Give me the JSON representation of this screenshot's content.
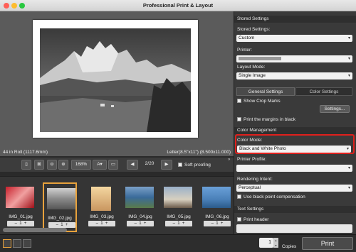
{
  "window": {
    "title": "Professional Print & Layout"
  },
  "preview": {
    "roll_info": "44 in Roll (1117.6mm)",
    "paper_info": "Letter(8.5\"x11\") (8.500x11.000)"
  },
  "toolbar": {
    "zoom": "168%",
    "page": "2/20",
    "soft_proofing": "Soft proofing"
  },
  "thumbnails": [
    {
      "label": "IMG_01.jpg",
      "count": "1"
    },
    {
      "label": "IMG_02.jpg",
      "count": "1"
    },
    {
      "label": "IMG_03.jpg",
      "count": "1"
    },
    {
      "label": "IMG_04.jpg",
      "count": "1"
    },
    {
      "label": "IMG_05.jpg",
      "count": "1"
    },
    {
      "label": "IMG_06.jpg",
      "count": "1"
    }
  ],
  "panel": {
    "stored_settings_header": "Stored Settings",
    "stored_settings_label": "Stored Settings:",
    "stored_settings_value": "Custom",
    "printer_label": "Printer:",
    "layout_mode_label": "Layout Mode:",
    "layout_mode_value": "Single Image",
    "tab_general": "General Settings",
    "tab_color": "Color Settings",
    "show_crop_marks": "Show Crop Marks",
    "settings_button": "Settings...",
    "print_margins": "Print the margins in black",
    "color_management_header": "Color Management",
    "color_mode_label": "Color Mode:",
    "color_mode_value": "Black and White Photo",
    "printer_profile_label": "Printer Profile:",
    "rendering_intent_label": "Rendering Intent:",
    "rendering_intent_value": "Perceptual",
    "black_point": "Use black point compensation",
    "text_settings_header": "Text Settings",
    "print_header": "Print header"
  },
  "footer": {
    "copies_value": "1",
    "copies_label": "Copies",
    "print_button": "Print"
  },
  "colors": {
    "highlight": "#e0201c",
    "accent": "#e8a23c"
  }
}
